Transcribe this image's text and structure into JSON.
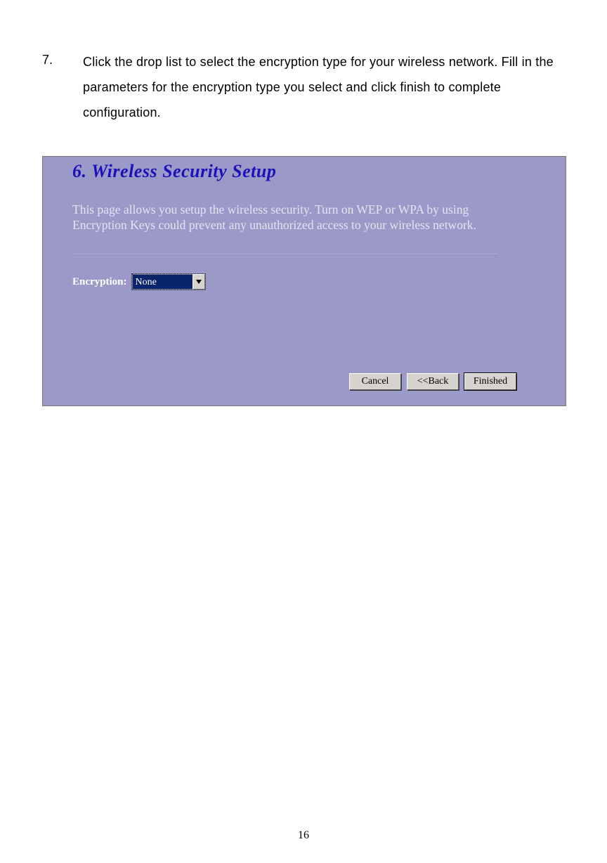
{
  "instruction": {
    "number": "7.",
    "text": "Click the drop list to select the encryption type for your wireless network. Fill in the parameters for the encryption type you select and click finish to complete configuration."
  },
  "panel": {
    "title": "6. Wireless Security Setup",
    "description": "This page allows you setup the wireless security. Turn on WEP or WPA by using Encryption Keys could prevent any unauthorized access to your wireless network.",
    "encryption_label": "Encryption:",
    "encryption_value": "None",
    "buttons": {
      "cancel": "Cancel",
      "back": "<<Back",
      "finished": "Finished"
    }
  },
  "page_number": "16"
}
